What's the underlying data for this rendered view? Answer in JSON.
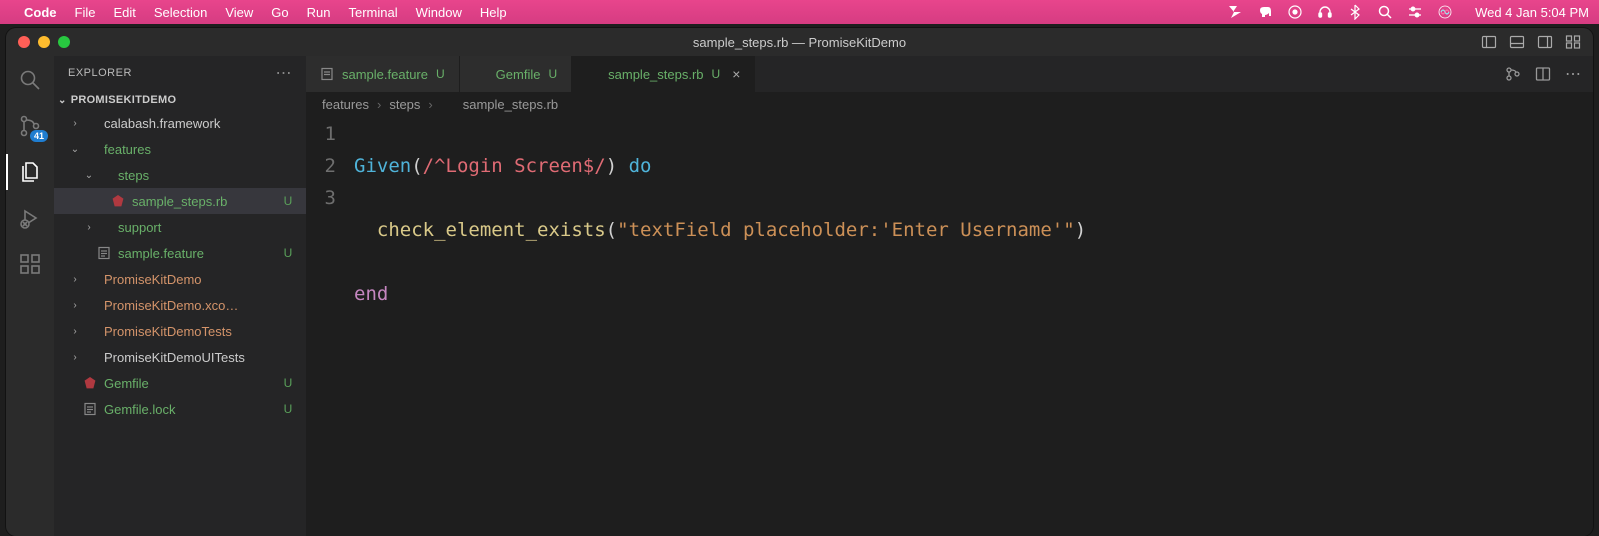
{
  "menubar": {
    "app": "Code",
    "items": [
      "File",
      "Edit",
      "Selection",
      "View",
      "Go",
      "Run",
      "Terminal",
      "Window",
      "Help"
    ],
    "datetime": "Wed 4 Jan  5:04 PM"
  },
  "window": {
    "title": "sample_steps.rb — PromiseKitDemo"
  },
  "activity": {
    "scm_badge": "41"
  },
  "sidebar": {
    "title": "EXPLORER",
    "section": "PROMISEKITDEMO",
    "tree": [
      {
        "name": "calabash.framework",
        "depth": 1,
        "kind": "folder",
        "chev": "right",
        "status": "dot"
      },
      {
        "name": "features",
        "depth": 1,
        "kind": "folder",
        "chev": "down",
        "color": "green",
        "status": "dot"
      },
      {
        "name": "steps",
        "depth": 2,
        "kind": "folder",
        "chev": "down",
        "color": "green",
        "status": "dot"
      },
      {
        "name": "sample_steps.rb",
        "depth": 3,
        "kind": "ruby",
        "color": "green",
        "status": "U",
        "selected": true
      },
      {
        "name": "support",
        "depth": 2,
        "kind": "folder",
        "chev": "right",
        "color": "green",
        "status": "dot"
      },
      {
        "name": "sample.feature",
        "depth": 2,
        "kind": "feature",
        "color": "green",
        "status": "U"
      },
      {
        "name": "PromiseKitDemo",
        "depth": 1,
        "kind": "folder",
        "chev": "right",
        "color": "orange",
        "status": "dot"
      },
      {
        "name": "PromiseKitDemo.xco…",
        "depth": 1,
        "kind": "folder",
        "chev": "right",
        "color": "orange",
        "status": "dot"
      },
      {
        "name": "PromiseKitDemoTests",
        "depth": 1,
        "kind": "folder",
        "chev": "right",
        "color": "orange",
        "status": "dot"
      },
      {
        "name": "PromiseKitDemoUITests",
        "depth": 1,
        "kind": "folder",
        "chev": "right"
      },
      {
        "name": "Gemfile",
        "depth": 1,
        "kind": "ruby",
        "color": "green",
        "status": "U"
      },
      {
        "name": "Gemfile.lock",
        "depth": 1,
        "kind": "feature",
        "color": "green",
        "status": "U"
      }
    ]
  },
  "tabs": [
    {
      "icon": "feature",
      "label": "sample.feature",
      "mark": "U",
      "color": "green"
    },
    {
      "icon": "ruby",
      "label": "Gemfile",
      "mark": "U",
      "color": "green"
    },
    {
      "icon": "ruby",
      "label": "sample_steps.rb",
      "mark": "U",
      "color": "green",
      "active": true,
      "close": true
    }
  ],
  "breadcrumb": {
    "parts": [
      "features",
      "steps"
    ],
    "file": "sample_steps.rb"
  },
  "code": {
    "lines": [
      "1",
      "2",
      "3"
    ],
    "l1_kw": "Given",
    "l1_open": "(",
    "l1_re": "/^Login Screen$/",
    "l1_close_do": ") ",
    "l1_do": "do",
    "l2_fn": "check_element_exists",
    "l2_open": "(",
    "l2_str": "\"textField placeholder:'Enter Username'\"",
    "l2_close": ")",
    "l3_end": "end"
  }
}
